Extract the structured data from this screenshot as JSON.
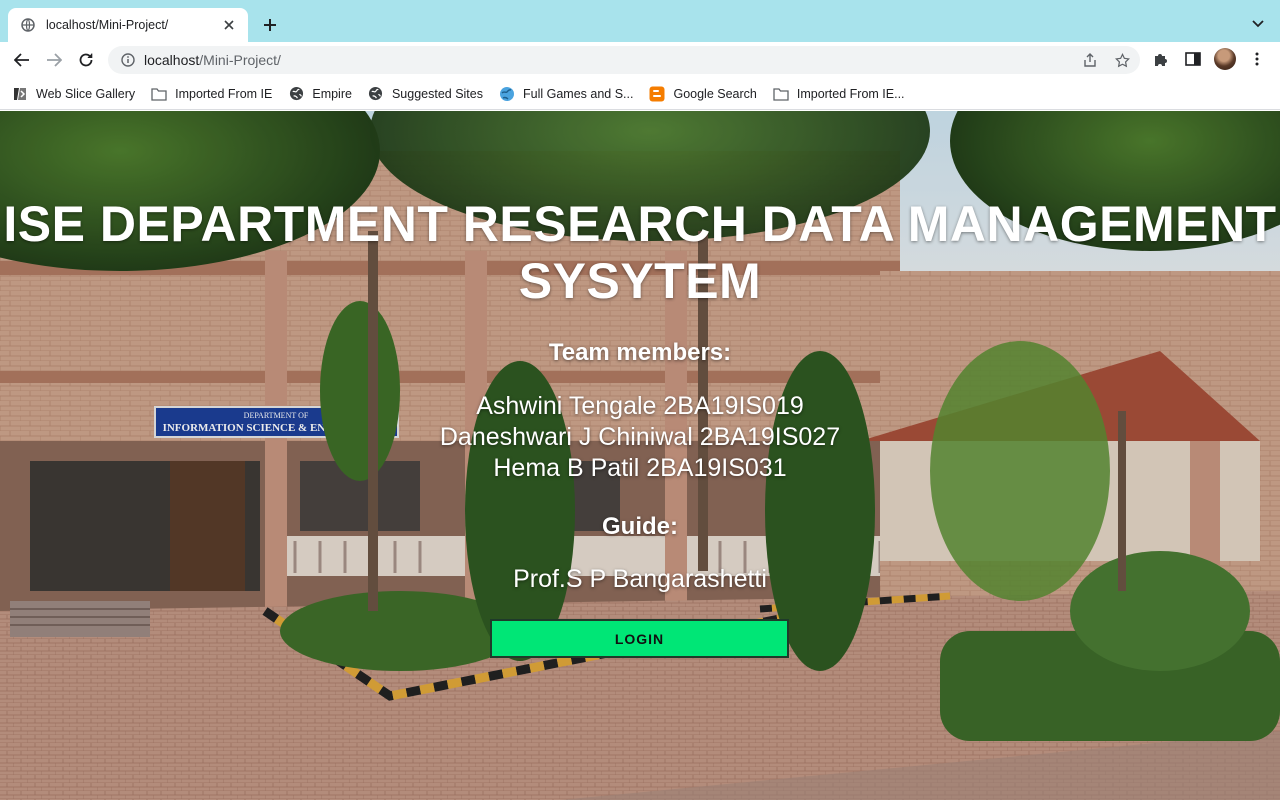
{
  "browser": {
    "tab": {
      "title": "localhost/Mini-Project/"
    },
    "address_bar": {
      "host": "localhost",
      "path": "/Mini-Project/"
    },
    "bookmarks": [
      {
        "label": "Web Slice Gallery",
        "icon": "web-slice-icon"
      },
      {
        "label": "Imported From IE",
        "icon": "folder-icon"
      },
      {
        "label": "Empire",
        "icon": "globe-icon"
      },
      {
        "label": "Suggested Sites",
        "icon": "globe-icon"
      },
      {
        "label": "Full Games and S...",
        "icon": "globe-blue-icon"
      },
      {
        "label": "Google Search",
        "icon": "blogger-icon"
      },
      {
        "label": "Imported From IE...",
        "icon": "folder-icon"
      }
    ],
    "colors": {
      "tabstrip": "#a8e3ec",
      "omnibox": "#f1f3f4"
    }
  },
  "page": {
    "title": "ISE DEPARTMENT RESEARCH DATA MANAGEMENT SYSYTEM",
    "team_label": "Team members:",
    "members": [
      "Ashwini Tengale 2BA19IS019",
      "Daneshwari J Chiniwal 2BA19IS027",
      "Hema B Patil 2BA19IS031"
    ],
    "guide_label": "Guide:",
    "guide_name": "Prof.S P Bangarashetti",
    "login_label": "LOGIN",
    "sign_text": "DEPARTMENT OF INFORMATION SCIENCE & ENGINEERING",
    "colors": {
      "login_button": "#00e676",
      "text": "#ffffff"
    }
  }
}
